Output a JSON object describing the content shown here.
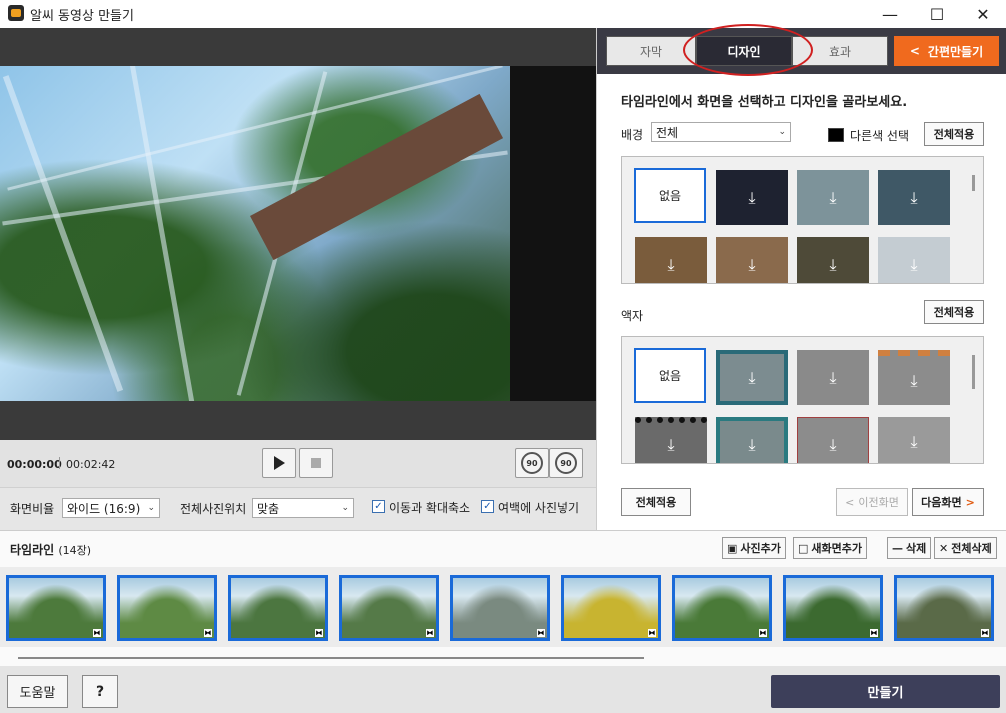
{
  "window": {
    "title": "알씨 동영상 만들기",
    "min": "—",
    "max": "☐",
    "close": "✕"
  },
  "player": {
    "current_time": "00:00:00",
    "total_time": "00:02:42",
    "rotate_left": "90",
    "rotate_right": "90"
  },
  "options": {
    "aspect_label": "화면비율",
    "aspect_value": "와이드 (16:9)",
    "position_label": "전체사진위치",
    "position_value": "맞춤",
    "pan_zoom_label": "이동과 확대축소",
    "pan_zoom_checked": true,
    "fill_margin_label": "여백에 사진넣기",
    "fill_margin_checked": true
  },
  "tabs": {
    "subtitle": "자막",
    "design": "디자인",
    "effect": "효과",
    "quick_make": "간편만들기"
  },
  "design": {
    "instruction": "타임라인에서 화면을 선택하고 디자인을 골라보세요.",
    "background_label": "배경",
    "background_filter": "전체",
    "other_color_label": "다른색 선택",
    "other_color_swatch": "#000000",
    "apply_all": "전체적용",
    "none_label": "없음",
    "frame_label": "액자",
    "bg_colors": [
      "#1e2230",
      "#7d939a",
      "#3f5866",
      "#7a5c3c",
      "#8a6a4c",
      "#4e4a38",
      "#c4ccd2"
    ],
    "frame_colors": [
      "#7c8c90",
      "#8a8a8a",
      "#8c8c8c",
      "#6a6a6a",
      "#7a8a8c",
      "#8c8c8c",
      "#9a9a9a"
    ],
    "prev_label": "이전화면",
    "next_label": "다음화면"
  },
  "timeline": {
    "label": "타임라인",
    "count": "(14장)",
    "add_photo": "사진추가",
    "add_new_screen": "새화면추가",
    "delete": "삭제",
    "delete_all": "전체삭제",
    "frame_colors": [
      "#4d7a3c",
      "#5e8a44",
      "#4c7640",
      "#557a48",
      "#7a8a80",
      "#c8b430",
      "#4a7a38",
      "#3c6a30",
      "#5a6a48"
    ]
  },
  "footer": {
    "help": "도움말",
    "question": "?",
    "make": "만들기"
  }
}
